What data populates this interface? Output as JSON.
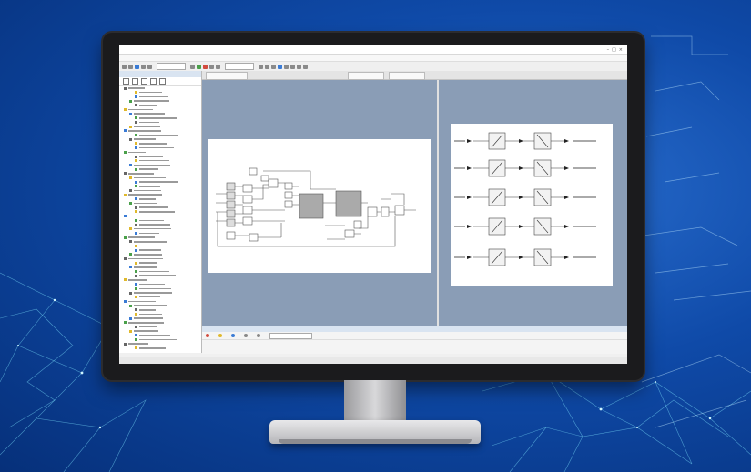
{
  "app": {
    "window_title": "",
    "menu_items": [
      "",
      "",
      "",
      "",
      "",
      "",
      "",
      "",
      "",
      "",
      "",
      ""
    ],
    "tabs": [
      "",
      "",
      ""
    ]
  },
  "left_panel": {
    "header": "",
    "tree_rows": 62
  },
  "bottom_panel": {
    "header": "",
    "items": [
      "",
      "",
      "",
      "",
      ""
    ],
    "search_placeholder": ""
  },
  "statusbar": {
    "left": "",
    "coords": "",
    "zoom": ""
  },
  "colors": {
    "background": "#0f4aa8",
    "canvas": "#8a9db6",
    "sheet": "#ffffff",
    "accent": "#3a7bd5"
  },
  "icons": [
    "minimize-icon",
    "maximize-icon",
    "close-icon",
    "folder-icon",
    "block-icon",
    "error-icon",
    "warning-icon",
    "info-icon"
  ]
}
